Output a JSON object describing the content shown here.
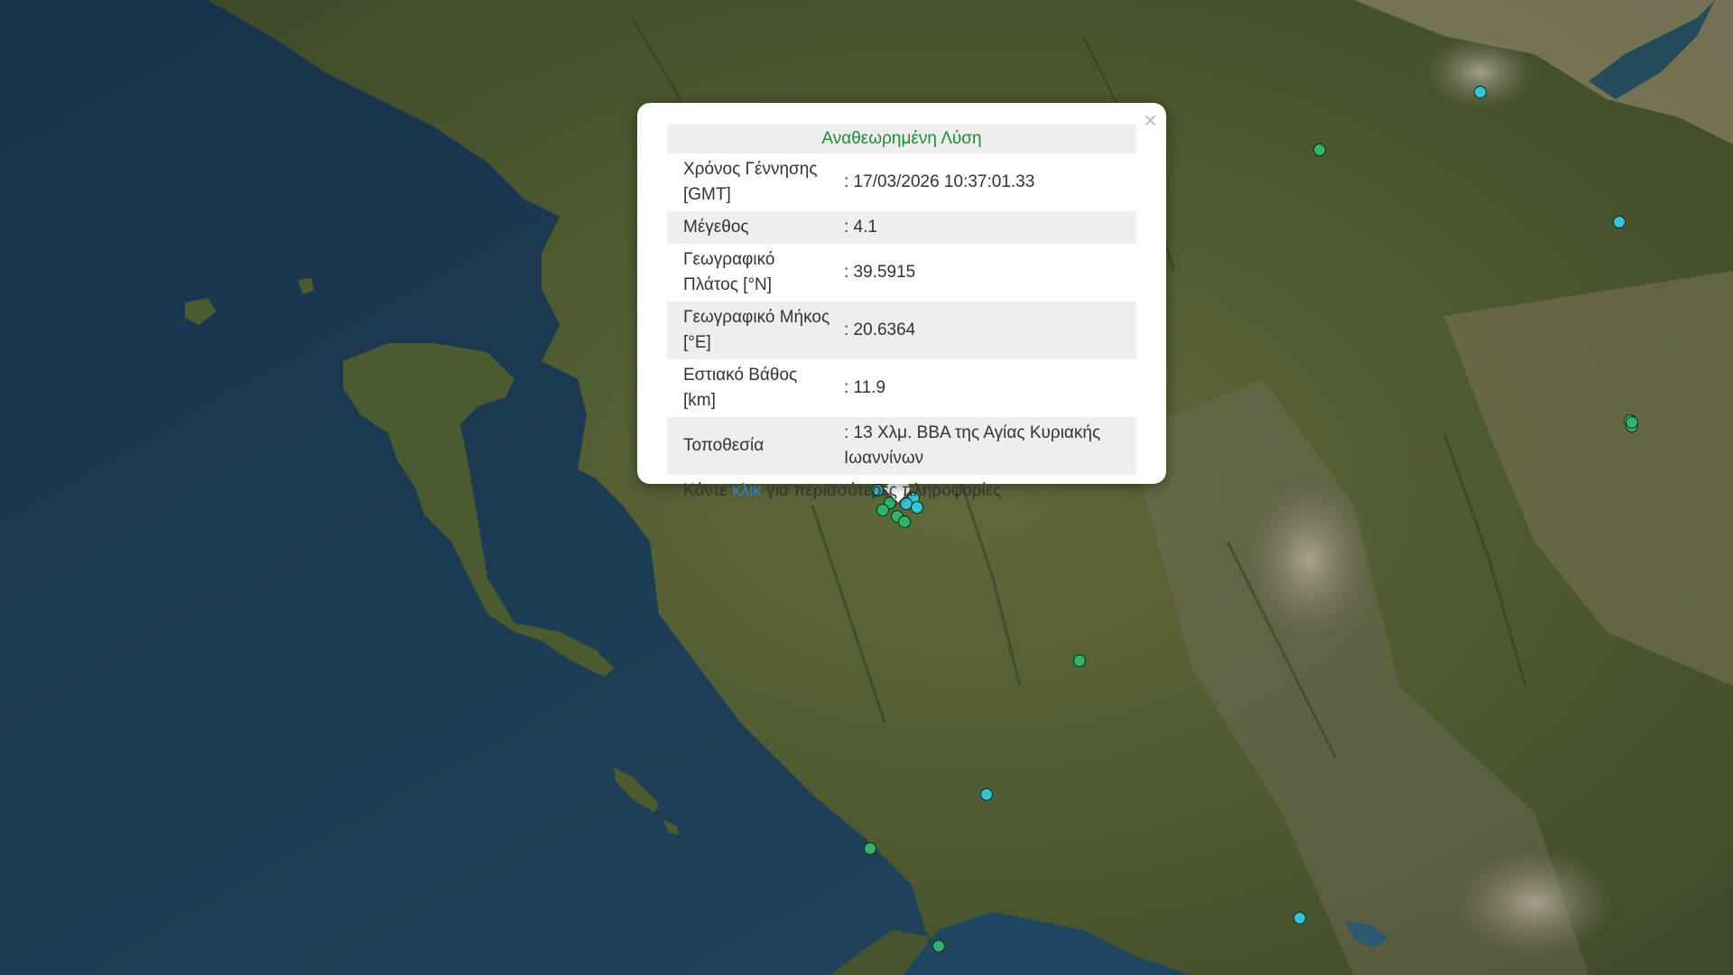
{
  "popup": {
    "close": "×",
    "title": "Αναθεωρημένη Λύση",
    "rows": [
      {
        "label": "Χρόνος Γέννησης [GMT]",
        "value": ": 17/03/2026 10:37:01.33"
      },
      {
        "label": "Μέγεθος",
        "value": ": 4.1"
      },
      {
        "label": "Γεωγραφικό Πλάτος [°N]",
        "value": ": 39.5915"
      },
      {
        "label": "Γεωγραφικό Μήκος [°E]",
        "value": ": 20.6364"
      },
      {
        "label": "Εστιακό Βάθος [km]",
        "value": ": 11.9"
      },
      {
        "label": "Τοποθεσία",
        "value": ": 13 Χλμ. ΒΒΑ της Αγίας Κυριακής Ιωαννίνων"
      }
    ],
    "footer_prefix": "Κάντε",
    "footer_link": "κλικ",
    "footer_suffix": "για περισσότερες πληροφορίες"
  },
  "colors": {
    "marker_green": "#2fb46a",
    "marker_cyan": "#35c3d8",
    "title_green": "#1a8f2f",
    "link_blue": "#2a86c8"
  },
  "markers": [
    {
      "color": "cyan"
    },
    {
      "color": "green"
    },
    {
      "color": "cyan"
    },
    {
      "color": "green"
    },
    {
      "color": "green"
    },
    {
      "color": "cyan"
    },
    {
      "color": "green"
    },
    {
      "color": "cyan"
    },
    {
      "color": "cyan"
    },
    {
      "color": "cyan"
    },
    {
      "color": "green"
    },
    {
      "color": "green"
    },
    {
      "color": "green"
    },
    {
      "color": "green"
    },
    {
      "color": "cyan"
    },
    {
      "color": "green"
    },
    {
      "color": "green"
    },
    {
      "color": "cyan"
    },
    {
      "color": "green"
    }
  ]
}
